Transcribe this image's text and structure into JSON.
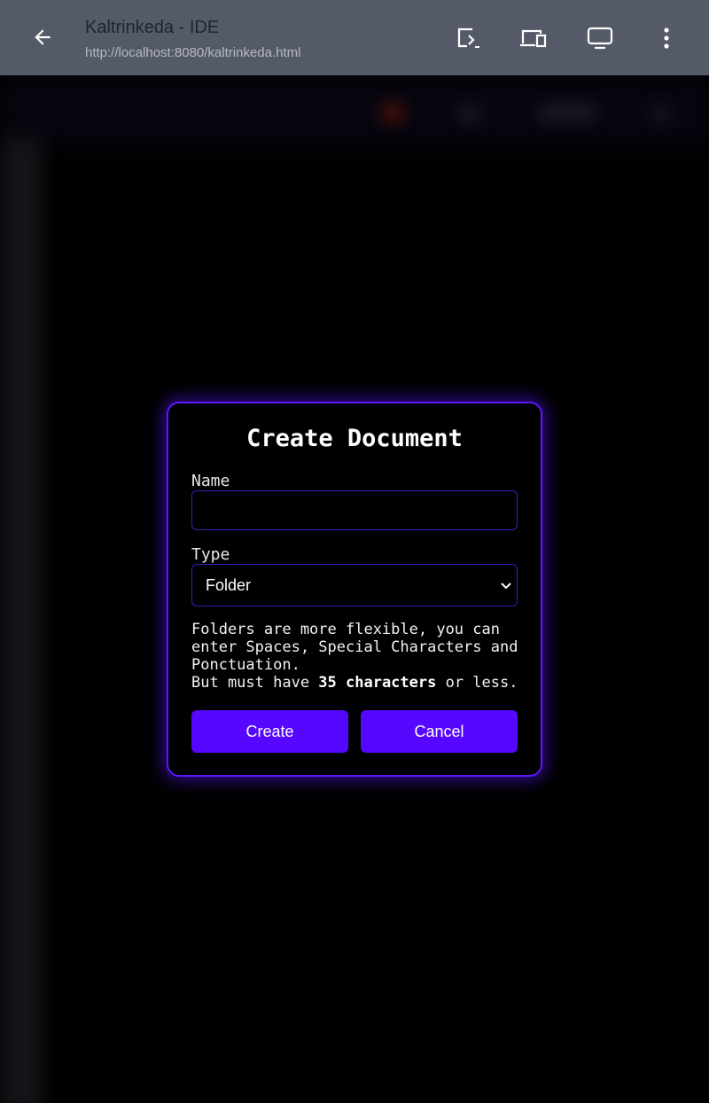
{
  "browser": {
    "title": "Kaltrinkeda - IDE",
    "url": "http://localhost:8080/kaltrinkeda.html",
    "icons": [
      "back-arrow-icon",
      "cast-screen-icon",
      "devices-icon",
      "monitor-icon",
      "more-vertical-icon"
    ]
  },
  "dialog": {
    "title": "Create Document",
    "name_label": "Name",
    "name_value": "",
    "type_label": "Type",
    "type_selected": "Folder",
    "help_line1": "Folders are more flexible, you can enter Spaces, Special Characters and Ponctuation.",
    "help_line2_prefix": "But must have ",
    "help_line2_bold": "35 characters",
    "help_line2_suffix": " or less.",
    "create_label": "Create",
    "cancel_label": "Cancel"
  },
  "colors": {
    "accent": "#5507ff",
    "border": "#5b17ff",
    "toolbar": "#545a67"
  }
}
